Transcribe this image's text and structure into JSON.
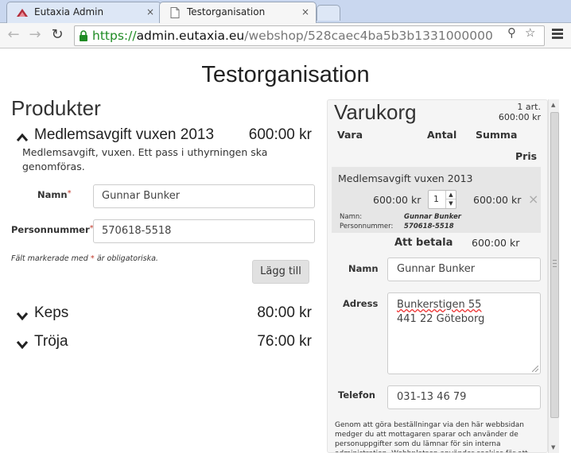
{
  "browser": {
    "tabs": [
      {
        "label": "Eutaxia Admin",
        "close": "×"
      },
      {
        "label": "Testorganisation",
        "close": "×"
      }
    ],
    "url": {
      "scheme": "https://",
      "host": "admin.eutaxia.eu",
      "path": "/webshop/528caec4ba5b3b1331000000"
    }
  },
  "page": {
    "title": "Testorganisation",
    "products_heading": "Produkter",
    "products": [
      {
        "name": "Medlemsavgift vuxen 2013",
        "price": "600:00 kr",
        "expanded": true
      },
      {
        "name": "Keps",
        "price": "80:00 kr",
        "expanded": false
      },
      {
        "name": "Tröja",
        "price": "76:00 kr",
        "expanded": false
      }
    ],
    "product_description": "Medlemsavgift, vuxen. Ett pass i uthyrningen ska genomföras.",
    "form": {
      "name_label": "Namn",
      "name_value": "Gunnar Bunker",
      "personnummer_label": "Personnummer",
      "personnummer_value": "570618-5518",
      "required_mark": "*",
      "footnote_before": "Fält markerade med",
      "footnote_after": "är obligatoriska.",
      "add_button": "Lägg till"
    }
  },
  "cart": {
    "title": "Varukorg",
    "count": "1 art.",
    "total_short": "600:00 kr",
    "columns": {
      "item": "Vara",
      "quantity": "Antal",
      "sum": "Summa",
      "price": "Pris"
    },
    "item": {
      "name": "Medlemsavgift vuxen 2013",
      "price": "600:00 kr",
      "quantity": "1",
      "sum": "600:00 kr",
      "remove": "×",
      "details": [
        {
          "label": "Namn:",
          "value": "Gunnar Bunker"
        },
        {
          "label": "Personnummer:",
          "value": "570618-5518"
        }
      ]
    },
    "total_label": "Att betala",
    "total_value": "600:00 kr",
    "checkout": {
      "name_label": "Namn",
      "name_value": "Gunnar Bunker",
      "address_label": "Adress",
      "address_line1": "Bunkerstigen 55",
      "address_line2": "441 22 Göteborg",
      "phone_label": "Telefon",
      "phone_value": "031-13 46 79"
    },
    "legal_text": "Genom att göra beställningar via den här webbsidan medger du att mottagaren sparar och använder de personuppgifter som du lämnar för sin interna administration. Webbplatsen använder cookies för att"
  },
  "icons": {
    "back": "arrow-left-icon",
    "forward": "arrow-right-icon",
    "reload": "reload-icon",
    "lock": "lock-icon",
    "search": "magnifier-icon",
    "bookmark": "star-icon",
    "menu": "hamburger-menu-icon"
  },
  "colors": {
    "https_green": "#1f8b24",
    "required_red": "#c0392b",
    "cart_background": "#f5f5f5"
  }
}
